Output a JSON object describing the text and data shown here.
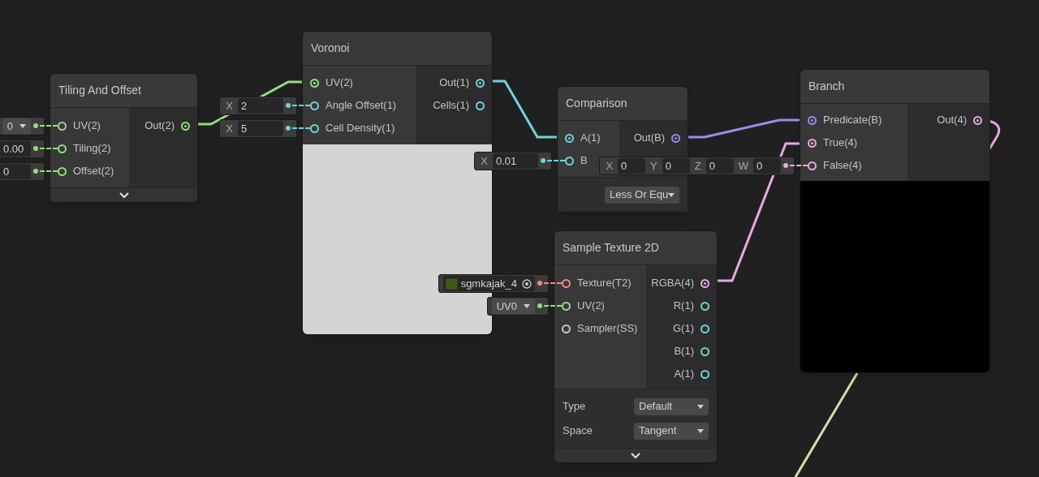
{
  "nodes": [
    {
      "title": "Tiling And Offset",
      "inputs": [
        {
          "label": "UV(2)",
          "color": "#8fe07d",
          "connected": false,
          "field": {
            "kind": "dropdown",
            "value": "0"
          }
        },
        {
          "label": "Tiling(2)",
          "color": "#8fe07d",
          "connected": false,
          "field": {
            "kind": "vector",
            "components": [
              {
                "value": "0.00"
              }
            ]
          }
        },
        {
          "label": "Offset(2)",
          "color": "#8fe07d",
          "connected": false,
          "field": {
            "kind": "vector",
            "components": [
              {
                "value": "0"
              }
            ]
          }
        }
      ],
      "outputs": [
        {
          "label": "Out(2)",
          "color": "#8fe07d",
          "connected": true
        }
      ],
      "expandable": true
    },
    {
      "title": "Voronoi",
      "inputs": [
        {
          "label": "UV(2)",
          "color": "#8fe07d",
          "connected": true
        },
        {
          "label": "Angle Offset(1)",
          "color": "#6fd3dc",
          "connected": false,
          "field": {
            "kind": "vector",
            "components": [
              {
                "axis": "X",
                "value": "2"
              }
            ]
          }
        },
        {
          "label": "Cell Density(1)",
          "color": "#6fd3dc",
          "connected": false,
          "field": {
            "kind": "vector",
            "components": [
              {
                "axis": "X",
                "value": "5"
              }
            ]
          }
        }
      ],
      "outputs": [
        {
          "label": "Out(1)",
          "color": "#6fd3dc",
          "connected": true
        },
        {
          "label": "Cells(1)",
          "color": "#6fd3dc",
          "connected": false
        }
      ],
      "preview": {
        "color": "#d4d4d4"
      }
    },
    {
      "title": "Comparison",
      "inputs": [
        {
          "label": "A(1)",
          "color": "#6fd3dc",
          "connected": true
        },
        {
          "label": "B",
          "color": "#6fd3dc",
          "connected": false,
          "field": {
            "kind": "vector",
            "components": [
              {
                "axis": "X",
                "value": "0.01"
              }
            ]
          }
        }
      ],
      "outputs": [
        {
          "label": "Out(B)",
          "color": "#9d8ce8",
          "connected": true
        }
      ],
      "controls": [
        {
          "value": "Less Or Equ"
        }
      ]
    },
    {
      "title": "Branch",
      "inputs": [
        {
          "label": "Predicate(B)",
          "color": "#9d8ce8",
          "connected": true
        },
        {
          "label": "True(4)",
          "color": "#e6a9e6",
          "connected": true
        },
        {
          "label": "False(4)",
          "color": "#e6a9e6",
          "connected": false,
          "field": {
            "kind": "vector",
            "components": [
              {
                "axis": "X",
                "value": "0"
              },
              {
                "axis": "Y",
                "value": "0"
              },
              {
                "axis": "Z",
                "value": "0"
              },
              {
                "axis": "W",
                "value": "0"
              }
            ]
          }
        }
      ],
      "outputs": [
        {
          "label": "Out(4)",
          "color": "#e6a9e6",
          "connected": true
        }
      ],
      "preview": {
        "color": "#000000"
      }
    },
    {
      "title": "Sample Texture 2D",
      "inputs": [
        {
          "label": "Texture(T2)",
          "color": "#f08a80",
          "connected": false,
          "field": {
            "kind": "texture",
            "value": "sgmkajak_4"
          }
        },
        {
          "label": "UV(2)",
          "color": "#8fe07d",
          "connected": false,
          "field": {
            "kind": "dropdown",
            "value": "UV0"
          }
        },
        {
          "label": "Sampler(SS)",
          "color": "#c8c8c8",
          "connected": false
        }
      ],
      "outputs": [
        {
          "label": "RGBA(4)",
          "color": "#e6a9e6",
          "connected": true
        },
        {
          "label": "R(1)",
          "color": "#6fd3dc",
          "connected": false
        },
        {
          "label": "G(1)",
          "color": "#6fd3dc",
          "connected": false
        },
        {
          "label": "B(1)",
          "color": "#6fd3dc",
          "connected": false
        },
        {
          "label": "A(1)",
          "color": "#6fd3dc",
          "connected": false
        }
      ],
      "controls": [
        {
          "label": "Type",
          "value": "Default"
        },
        {
          "label": "Space",
          "value": "Tangent"
        }
      ],
      "expandable": true
    }
  ]
}
